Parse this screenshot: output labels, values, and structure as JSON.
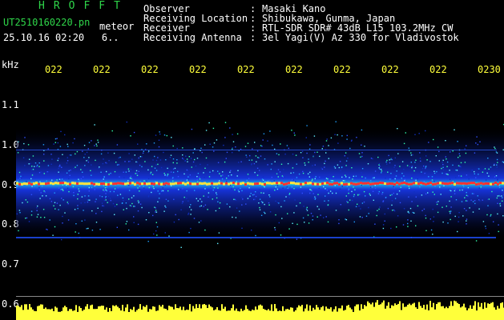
{
  "header": {
    "brand": "HROFFT",
    "filename": "UT2510160220.pn",
    "kind": "meteor",
    "datetime": "25.10.16 02:20",
    "count": "6..",
    "meta": [
      {
        "label": "Observer",
        "value": "Masaki Kano"
      },
      {
        "label": "Receiving Location",
        "value": "Shibukawa, Gunma, Japan"
      },
      {
        "label": "Receiver",
        "value": "RTL-SDR SDR# 43dB L15 103.2MHz CW"
      },
      {
        "label": "Receiving Antenna",
        "value": "3el Yagi(V) Az 330 for Vladivostok"
      }
    ]
  },
  "axis": {
    "unit": "kHz",
    "time_ticks": [
      "022",
      "022",
      "022",
      "022",
      "022",
      "022",
      "022",
      "022",
      "022",
      "0230"
    ],
    "freq_labels": [
      "1.1",
      "1.0",
      "0.9",
      "0.8",
      "0.7",
      "0.6"
    ]
  },
  "colors": {
    "header_green": "#2fd64a",
    "tick_yellow": "#ffff3a",
    "signal_red": "#ff3030",
    "noise_blue": "#1a3cff"
  }
}
